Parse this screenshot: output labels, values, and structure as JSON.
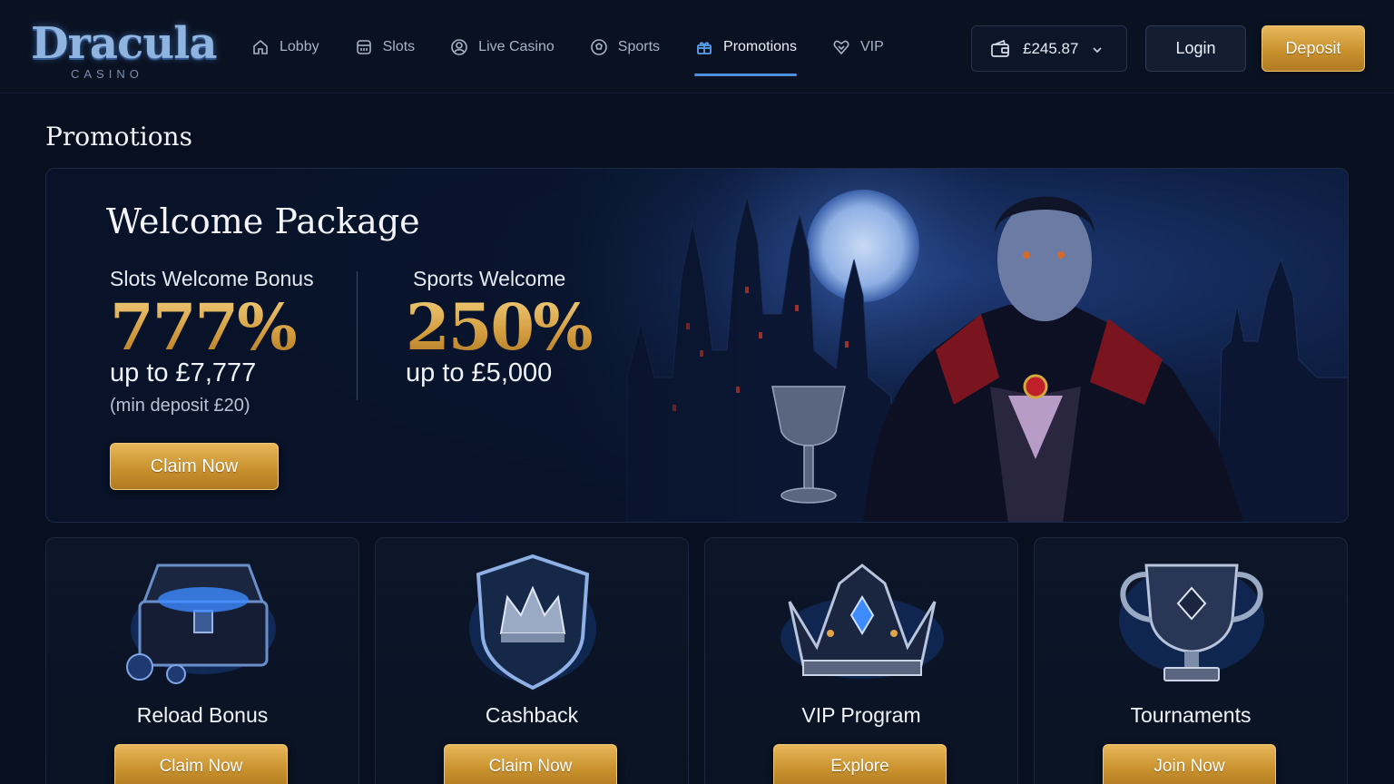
{
  "brand": {
    "name": "Dracula",
    "sub": "CASINO"
  },
  "nav": {
    "items": [
      {
        "label": "Lobby",
        "icon": "home-icon"
      },
      {
        "label": "Slots",
        "icon": "slot-machine-icon"
      },
      {
        "label": "Live Casino",
        "icon": "live-casino-icon"
      },
      {
        "label": "Sports",
        "icon": "football-icon"
      },
      {
        "label": "Promotions",
        "icon": "gift-icon",
        "active": true
      },
      {
        "label": "VIP",
        "icon": "heart-diamond-icon"
      }
    ]
  },
  "account": {
    "balance": "£245.87",
    "login_label": "Login",
    "deposit_label": "Deposit"
  },
  "page": {
    "title": "Promotions"
  },
  "hero": {
    "title": "Welcome Package",
    "slots": {
      "label": "Slots Welcome Bonus",
      "percent": "777%",
      "upto": "up to £7,777",
      "min": "(min deposit £20)"
    },
    "sports": {
      "label": "Sports Welcome",
      "percent": "250%",
      "upto": "up to £5,000"
    },
    "cta": "Claim Now"
  },
  "cards": [
    {
      "title": "Reload Bonus",
      "cta": "Claim Now",
      "icon": "treasure-chest-icon"
    },
    {
      "title": "Cashback",
      "cta": "Claim Now",
      "icon": "crown-shield-icon"
    },
    {
      "title": "VIP Program",
      "cta": "Explore",
      "icon": "crown-icon"
    },
    {
      "title": "Tournaments",
      "cta": "Join Now",
      "icon": "trophy-icon"
    }
  ],
  "colors": {
    "accent_gold": "#d19a3c",
    "accent_blue": "#4a8fe0",
    "background": "#08101f"
  }
}
